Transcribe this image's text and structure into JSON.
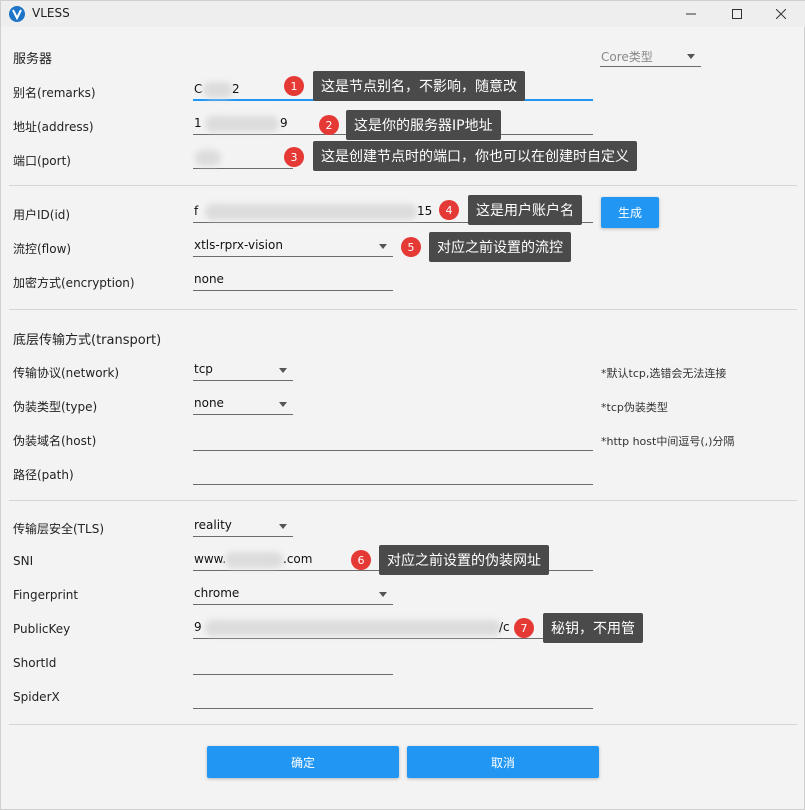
{
  "window": {
    "title": "VLESS"
  },
  "server": {
    "section_title": "服务器",
    "core_type_placeholder": "Core类型",
    "remarks": {
      "label": "别名(remarks)",
      "value_start": "C",
      "value_end": "2"
    },
    "address": {
      "label": "地址(address)",
      "value_start": "1",
      "value_end": "9"
    },
    "port": {
      "label": "端口(port)"
    }
  },
  "user": {
    "id": {
      "label": "用户ID(id)",
      "value_start": "f",
      "value_end": "15"
    },
    "generate_button": "生成",
    "flow": {
      "label": "流控(flow)",
      "value": "xtls-rprx-vision"
    },
    "encryption": {
      "label": "加密方式(encryption)",
      "value": "none"
    }
  },
  "transport": {
    "section_title": "底层传输方式(transport)",
    "network": {
      "label": "传输协议(network)",
      "value": "tcp",
      "hint": "*默认tcp,选错会无法连接"
    },
    "type": {
      "label": "伪装类型(type)",
      "value": "none",
      "hint": "*tcp伪装类型"
    },
    "host": {
      "label": "伪装域名(host)",
      "value": "",
      "hint": "*http host中间逗号(,)分隔"
    },
    "path": {
      "label": "路径(path)",
      "value": ""
    }
  },
  "tls": {
    "security": {
      "label": "传输层安全(TLS)",
      "value": "reality"
    },
    "sni": {
      "label": "SNI",
      "value_start": "www.",
      "value_end": ".com"
    },
    "fingerprint": {
      "label": "Fingerprint",
      "value": "chrome"
    },
    "public_key": {
      "label": "PublicKey",
      "value_start": "9",
      "value_end": "/c"
    },
    "short_id": {
      "label": "ShortId",
      "value": ""
    },
    "spider_x": {
      "label": "SpiderX",
      "value": ""
    }
  },
  "footer": {
    "confirm": "确定",
    "cancel": "取消"
  },
  "annotations": [
    {
      "num": "1",
      "text": "这是节点别名，不影响，随意改"
    },
    {
      "num": "2",
      "text": "这是你的服务器IP地址"
    },
    {
      "num": "3",
      "text": "这是创建节点时的端口，你也可以在创建时自定义"
    },
    {
      "num": "4",
      "text": "这是用户账户名"
    },
    {
      "num": "5",
      "text": "对应之前设置的流控"
    },
    {
      "num": "6",
      "text": "对应之前设置的伪装网址"
    },
    {
      "num": "7",
      "text": "秘钥，不用管"
    }
  ],
  "colors": {
    "accent": "#2196f3",
    "badge": "#e53935",
    "bubble": "#4a4a4a",
    "app_icon": "#1e74c8"
  }
}
